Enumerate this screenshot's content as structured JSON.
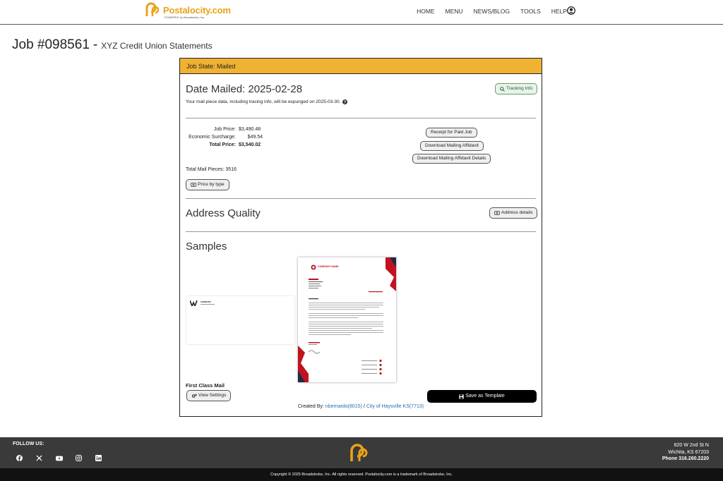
{
  "header": {
    "brand": "Postalocity.com",
    "brand_sub": "POWERED by Broadstroke, Inc.",
    "nav": [
      "HOME",
      "MENU",
      "NEWS/BLOG",
      "TOOLS",
      "HELP"
    ]
  },
  "page": {
    "job_number": "Job #098561",
    "separator": "-",
    "job_name": "XYZ Credit Union Statements"
  },
  "card": {
    "job_state": "Job State: Mailed",
    "date_mailed": "Date Mailed: 2025-02-28",
    "tracking_button": "Tracking Info",
    "expunge_note": "Your mail piece data, including tracing info, will be expunged on 2025-03-30.",
    "job_price_label": "Job Price:",
    "job_price": "$3,490.48",
    "surcharge_label": "Economic Surcharge:",
    "surcharge": "$49.54",
    "total_label": "Total Price:",
    "total": "$3,540.02",
    "receipt_button": "Receipt for Paid Job",
    "affidavit_button": "Download Mailing Affidavit",
    "affidavit_details_button": "Download Mailing Affidavit Details",
    "total_pieces": "Total Mail Pieces: 3516",
    "price_by_type_button": "Price by type",
    "address_quality_title": "Address Quality",
    "address_details_button": "Address details",
    "samples_title": "Samples",
    "mail_class": "First Class Mail",
    "view_settings_button": "View Settings",
    "save_template_button": "Save as Template",
    "created_by_label": "Created By:",
    "created_by_user": "nbernardo(8015)",
    "created_by_sep": "/",
    "created_by_org": "City of Haysville KS(7713)"
  },
  "sample_letter": {
    "company": "COMPANY NAME",
    "envelope_company": "COMPANY"
  },
  "footer": {
    "follow_us": "FOLLOW US:",
    "address_line1": "820 W 2nd St N",
    "address_line2": "Wichita, KS 67203",
    "phone": "Phone 316.260.2220",
    "copyright": "Copyright © 2025 Broadstroke, Inc. All rights reserved. Postalocity.com is a trademark of Broadstroke, Inc."
  },
  "colors": {
    "accent": "#f0b232",
    "brand": "#e8a317",
    "footer": "#3a3a3a",
    "link": "#1f6fb5"
  }
}
